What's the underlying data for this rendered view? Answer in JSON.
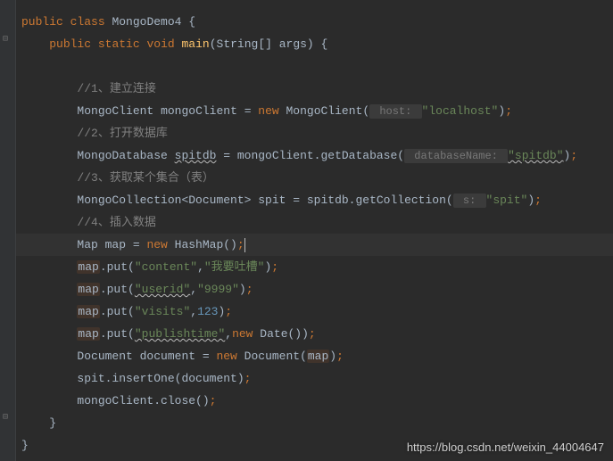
{
  "code": {
    "class_decl": {
      "public": "public",
      "class": "class",
      "name": "MongoDemo4",
      "brace": " {"
    },
    "main_decl": {
      "public": "public",
      "static": "static",
      "void": "void",
      "name": "main",
      "params": "(String[] args) {"
    },
    "c1": "//1、建立连接",
    "l1": {
      "type1": "MongoClient",
      "var": "mongoClient",
      "eq": " = ",
      "new": "new",
      "type2": " MongoClient(",
      "hint": " host: ",
      "str": "\"localhost\"",
      "end": ")",
      "semi": ";"
    },
    "c2": "//2、打开数据库",
    "l2": {
      "type1": "MongoDatabase ",
      "var": "spitdb",
      "eq": " = mongoClient.getDatabase(",
      "hint": " databaseName: ",
      "str": "\"spitdb\"",
      "end": ")",
      "semi": ";"
    },
    "c3": "//3、获取某个集合（表）",
    "l3": {
      "pre": "MongoCollection<Document> spit = spitdb.getCollection(",
      "hint": " s: ",
      "str": "\"spit\"",
      "end": ")",
      "semi": ";"
    },
    "c4": "//4、插入数据",
    "l4": {
      "pre": "Map map = ",
      "new": "new",
      "type": " HashMap()",
      "semi": ";"
    },
    "l5": {
      "obj": "map",
      "call": ".put(",
      "k": "\"content\"",
      "comma": ",",
      "v": "\"我要吐槽\"",
      "end": ")",
      "semi": ";"
    },
    "l6": {
      "obj": "map",
      "call": ".put(",
      "k": "\"userid\"",
      "comma": ",",
      "v": "\"9999\"",
      "end": ")",
      "semi": ";"
    },
    "l7": {
      "obj": "map",
      "call": ".put(",
      "k": "\"visits\"",
      "comma": ",",
      "v": "123",
      "end": ")",
      "semi": ";"
    },
    "l8": {
      "obj": "map",
      "call": ".put(",
      "k": "\"publishtime\"",
      "comma": ",",
      "new": "new",
      "type": " Date()",
      "end": ")",
      "semi": ";"
    },
    "l9": {
      "pre": "Document document = ",
      "new": "new",
      "type": " Document(",
      "arg": "map",
      "end": ")",
      "semi": ";"
    },
    "l10": {
      "pre": "spit.insertOne(document)",
      "semi": ";"
    },
    "l11": {
      "pre": "mongoClient.close()",
      "semi": ";"
    },
    "close1": "}",
    "close2": "}"
  },
  "watermark": "https://blog.csdn.net/weixin_44004647"
}
